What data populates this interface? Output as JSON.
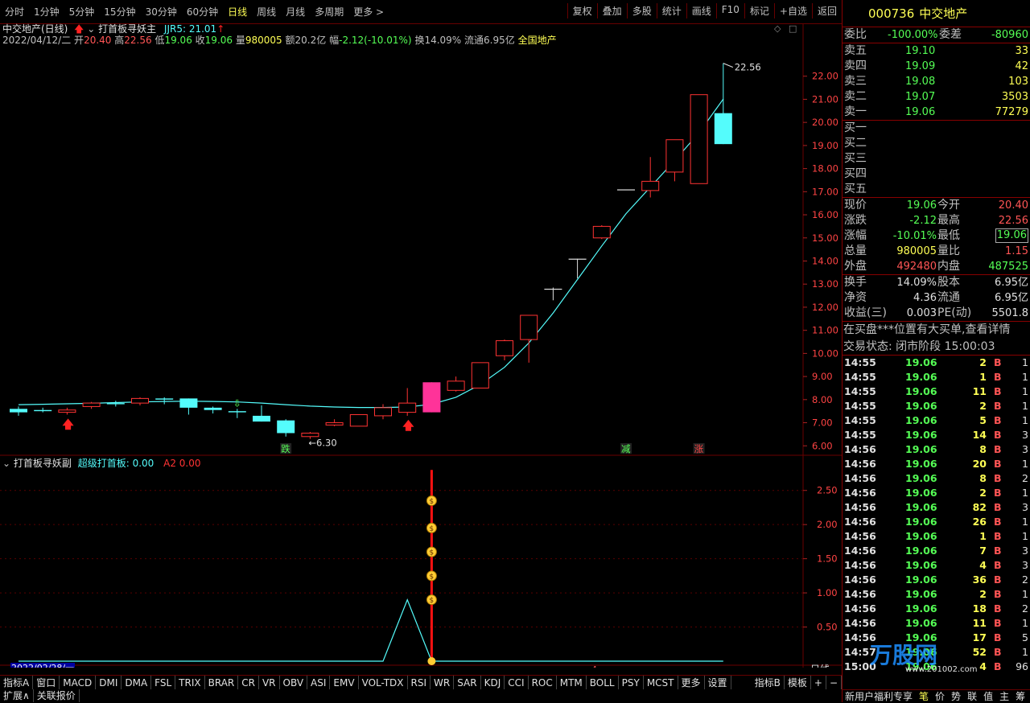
{
  "toolbar": {
    "periods": [
      "分时",
      "1分钟",
      "5分钟",
      "15分钟",
      "30分钟",
      "60分钟",
      "日线",
      "周线",
      "月线",
      "多周期",
      "更多 >"
    ],
    "active": "日线",
    "actions": [
      "复权",
      "叠加",
      "多股",
      "统计",
      "画线",
      "F10",
      "标记",
      "+自选",
      "返回"
    ]
  },
  "chart_header": {
    "stock": "中交地产(日线)",
    "indicator_name": "打首板寻妖主",
    "jjr": "JJR5: 21.01",
    "date": "2022/04/12/二",
    "open_label": "开",
    "open": "20.40",
    "high_label": "高",
    "high": "22.56",
    "low_label": "低",
    "low": "19.06",
    "close_label": "收",
    "close": "19.06",
    "vol_label": "量",
    "vol": "980005",
    "amt_label": "额",
    "amt": "20.2亿",
    "chg_label": "幅",
    "chg": "-2.12(-10.01%)",
    "turn": "换14.09%",
    "float": "流通6.95亿",
    "market": "全国地产"
  },
  "sub_header": {
    "name": "打首板寻妖副",
    "s1": "超级打首板: 0.00",
    "s2": "A2  0.00"
  },
  "chart_annotations": {
    "high_mark": "22.56",
    "low_mark": "6.30",
    "die": "跌",
    "jian": "减",
    "zhang": "涨",
    "date_label": "2022/02/28/一",
    "four": "4",
    "period_label": "日线"
  },
  "chart_data": [
    {
      "type": "candlestick",
      "y_ticks": [
        "22.00",
        "21.00",
        "20.00",
        "19.00",
        "18.00",
        "17.00",
        "16.00",
        "15.00",
        "14.00",
        "13.00",
        "12.00",
        "11.00",
        "10.00",
        "9.00",
        "8.00",
        "7.00",
        "6.00"
      ],
      "ylim": [
        5.8,
        23.0
      ],
      "candles": [
        {
          "o": 7.6,
          "c": 7.45,
          "h": 7.7,
          "l": 7.3
        },
        {
          "o": 7.55,
          "c": 7.5,
          "h": 7.65,
          "l": 7.45
        },
        {
          "o": 7.45,
          "c": 7.55,
          "h": 7.65,
          "l": 7.35
        },
        {
          "o": 7.7,
          "c": 7.85,
          "h": 7.9,
          "l": 7.6
        },
        {
          "o": 7.85,
          "c": 7.8,
          "h": 7.95,
          "l": 7.7
        },
        {
          "o": 7.85,
          "c": 8.05,
          "h": 8.1,
          "l": 7.75
        },
        {
          "o": 8.05,
          "c": 8.0,
          "h": 8.1,
          "l": 7.8
        },
        {
          "o": 8.05,
          "c": 7.65,
          "h": 8.05,
          "l": 7.35
        },
        {
          "o": 7.65,
          "c": 7.55,
          "h": 7.7,
          "l": 7.4
        },
        {
          "o": 7.5,
          "c": 7.45,
          "h": 7.6,
          "l": 7.2
        },
        {
          "o": 7.3,
          "c": 7.05,
          "h": 7.75,
          "l": 7.05
        },
        {
          "o": 7.1,
          "c": 6.55,
          "h": 7.15,
          "l": 6.4
        },
        {
          "o": 6.4,
          "c": 6.55,
          "h": 6.6,
          "l": 6.3
        },
        {
          "o": 6.9,
          "c": 7.0,
          "h": 7.15,
          "l": 6.85
        },
        {
          "o": 6.85,
          "c": 7.35,
          "h": 7.35,
          "l": 6.85
        },
        {
          "o": 7.3,
          "c": 7.65,
          "h": 7.8,
          "l": 7.15
        },
        {
          "o": 7.45,
          "c": 7.85,
          "h": 8.5,
          "l": 7.3
        },
        {
          "o": 7.45,
          "c": 8.75,
          "h": 8.75,
          "l": 7.45
        },
        {
          "o": 8.4,
          "c": 8.8,
          "h": 9.0,
          "l": 8.35
        },
        {
          "o": 8.5,
          "c": 9.6,
          "h": 9.6,
          "l": 8.5
        },
        {
          "o": 9.9,
          "c": 10.55,
          "h": 10.6,
          "l": 9.7
        },
        {
          "o": 10.6,
          "c": 11.65,
          "h": 11.65,
          "l": 9.6
        },
        {
          "o": 12.8,
          "c": 12.8,
          "h": 12.85,
          "l": 12.3
        },
        {
          "o": 14.1,
          "c": 14.1,
          "h": 14.1,
          "l": 13.25
        },
        {
          "o": 15.0,
          "c": 15.5,
          "h": 15.55,
          "l": 14.95
        },
        {
          "o": 17.1,
          "c": 17.1,
          "h": 17.1,
          "l": 17.1
        },
        {
          "o": 17.05,
          "c": 17.45,
          "h": 18.5,
          "l": 16.75
        },
        {
          "o": 17.85,
          "c": 19.25,
          "h": 19.25,
          "l": 17.45
        },
        {
          "o": 17.35,
          "c": 21.2,
          "h": 21.2,
          "l": 17.35
        },
        {
          "o": 20.4,
          "c": 19.06,
          "h": 22.56,
          "l": 19.06
        }
      ],
      "ma": [
        7.78,
        7.8,
        7.82,
        7.84,
        7.87,
        7.9,
        7.92,
        7.93,
        7.92,
        7.9,
        7.85,
        7.78,
        7.72,
        7.68,
        7.66,
        7.66,
        7.68,
        7.8,
        8.1,
        8.65,
        9.4,
        10.45,
        11.75,
        13.2,
        14.65,
        16.05,
        17.2,
        18.35,
        19.55,
        21.01
      ]
    },
    {
      "type": "line",
      "y_ticks": [
        "2.50",
        "2.00",
        "1.50",
        "1.00",
        "0.50"
      ],
      "ylim": [
        0,
        2.85
      ],
      "line": [
        0,
        0,
        0,
        0,
        0,
        0,
        0,
        0,
        0,
        0,
        0,
        0,
        0,
        0,
        0,
        0,
        0.9,
        0,
        0,
        0,
        0,
        0,
        0,
        0,
        0,
        0,
        0,
        0,
        0,
        0
      ],
      "spike_max": 2.8,
      "coins": [
        0.9,
        1.25,
        1.6,
        1.95,
        2.35
      ]
    }
  ],
  "right_panel": {
    "code": "000736",
    "name": "中交地产",
    "weibi_label": "委比",
    "weibi": "-100.00%",
    "weicha_label": "委差",
    "weicha": "-80960",
    "asks": [
      {
        "label": "卖五",
        "price": "19.10",
        "vol": "33"
      },
      {
        "label": "卖四",
        "price": "19.09",
        "vol": "42"
      },
      {
        "label": "卖三",
        "price": "19.08",
        "vol": "103"
      },
      {
        "label": "卖二",
        "price": "19.07",
        "vol": "3503"
      },
      {
        "label": "卖一",
        "price": "19.06",
        "vol": "77279"
      }
    ],
    "bids": [
      "买一",
      "买二",
      "买三",
      "买四",
      "买五"
    ],
    "quote": [
      {
        "l1": "现价",
        "v1": "19.06",
        "c1": "grn",
        "l2": "今开",
        "v2": "20.40",
        "c2": "red"
      },
      {
        "l1": "涨跌",
        "v1": "-2.12",
        "c1": "grn",
        "l2": "最高",
        "v2": "22.56",
        "c2": "red"
      },
      {
        "l1": "涨幅",
        "v1": "-10.01%",
        "c1": "grn",
        "l2": "最低",
        "v2": "19.06",
        "c2": "grn"
      },
      {
        "l1": "总量",
        "v1": "980005",
        "c1": "yel",
        "l2": "量比",
        "v2": "1.15",
        "c2": "red"
      },
      {
        "l1": "外盘",
        "v1": "492480",
        "c1": "red",
        "l2": "内盘",
        "v2": "487525",
        "c2": "grn"
      }
    ],
    "fin": [
      {
        "l1": "换手",
        "v1": "14.09%",
        "l2": "股本",
        "v2": "6.95亿"
      },
      {
        "l1": "净资",
        "v1": "4.36",
        "l2": "流通",
        "v2": "6.95亿"
      },
      {
        "l1": "收益(三)",
        "v1": "0.003",
        "l2": "PE(动)",
        "v2": "5501.8"
      }
    ],
    "notice": "在买盘***位置有大买单,查看详情",
    "status": "交易状态: 闭市阶段 15:00:03",
    "ticks": [
      {
        "t": "14:55",
        "p": "19.06",
        "v": "2",
        "bs": "B",
        "n": "1"
      },
      {
        "t": "14:55",
        "p": "19.06",
        "v": "1",
        "bs": "B",
        "n": "1"
      },
      {
        "t": "14:55",
        "p": "19.06",
        "v": "11",
        "bs": "B",
        "n": "1"
      },
      {
        "t": "14:55",
        "p": "19.06",
        "v": "2",
        "bs": "B",
        "n": "1"
      },
      {
        "t": "14:55",
        "p": "19.06",
        "v": "5",
        "bs": "B",
        "n": "1"
      },
      {
        "t": "14:55",
        "p": "19.06",
        "v": "14",
        "bs": "B",
        "n": "3"
      },
      {
        "t": "14:56",
        "p": "19.06",
        "v": "8",
        "bs": "B",
        "n": "3"
      },
      {
        "t": "14:56",
        "p": "19.06",
        "v": "20",
        "bs": "B",
        "n": "1"
      },
      {
        "t": "14:56",
        "p": "19.06",
        "v": "8",
        "bs": "B",
        "n": "2"
      },
      {
        "t": "14:56",
        "p": "19.06",
        "v": "2",
        "bs": "B",
        "n": "1"
      },
      {
        "t": "14:56",
        "p": "19.06",
        "v": "82",
        "bs": "B",
        "n": "3"
      },
      {
        "t": "14:56",
        "p": "19.06",
        "v": "26",
        "bs": "B",
        "n": "1"
      },
      {
        "t": "14:56",
        "p": "19.06",
        "v": "1",
        "bs": "B",
        "n": "1"
      },
      {
        "t": "14:56",
        "p": "19.06",
        "v": "7",
        "bs": "B",
        "n": "3"
      },
      {
        "t": "14:56",
        "p": "19.06",
        "v": "4",
        "bs": "B",
        "n": "3"
      },
      {
        "t": "14:56",
        "p": "19.06",
        "v": "36",
        "bs": "B",
        "n": "2"
      },
      {
        "t": "14:56",
        "p": "19.06",
        "v": "2",
        "bs": "B",
        "n": "1"
      },
      {
        "t": "14:56",
        "p": "19.06",
        "v": "18",
        "bs": "B",
        "n": "2"
      },
      {
        "t": "14:56",
        "p": "19.06",
        "v": "11",
        "bs": "B",
        "n": "1"
      },
      {
        "t": "14:56",
        "p": "19.06",
        "v": "17",
        "bs": "B",
        "n": "5"
      },
      {
        "t": "14:57",
        "p": "19.06",
        "v": "52",
        "bs": "B",
        "n": "1"
      },
      {
        "t": "15:00",
        "p": "19.06",
        "v": "4",
        "bs": "B",
        "n": "96"
      }
    ]
  },
  "bottom": {
    "tabs": [
      "指标A",
      "窗口",
      "MACD",
      "DMI",
      "DMA",
      "FSL",
      "TRIX",
      "BRAR",
      "CR",
      "VR",
      "OBV",
      "ASI",
      "EMV",
      "VOL-TDX",
      "RSI",
      "WR",
      "SAR",
      "KDJ",
      "CCI",
      "ROC",
      "MTM",
      "BOLL",
      "PSY",
      "MCST",
      "更多",
      "设置"
    ],
    "tabs_right": [
      "指标B",
      "模板",
      "+",
      "−"
    ],
    "row2": [
      "扩展∧",
      "关联报价"
    ],
    "rp_bottom": [
      "新用户福利专享",
      "笔",
      "价",
      "势",
      "联",
      "值",
      "主",
      "筹"
    ],
    "watermark": "万股网",
    "watermark_url": "www.201002.com"
  },
  "colors": {
    "up": "#ff3333",
    "down": "#54fcfc",
    "limit": "#ff3399",
    "ma": "#54fcfc",
    "grid": "#6b0000"
  }
}
